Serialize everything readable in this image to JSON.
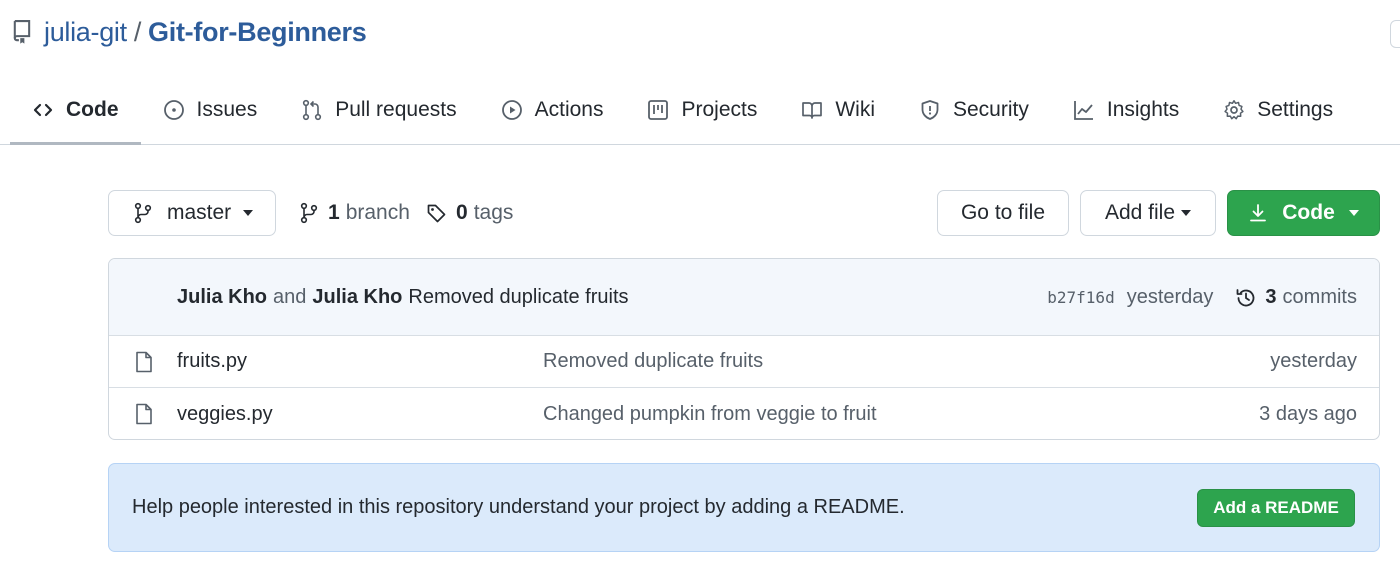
{
  "repo": {
    "owner": "julia-git",
    "separator": "/",
    "name": "Git-for-Beginners"
  },
  "tabs": [
    {
      "label": "Code",
      "icon": "code-icon",
      "active": true
    },
    {
      "label": "Issues",
      "icon": "issue-opened-icon"
    },
    {
      "label": "Pull requests",
      "icon": "git-pull-request-icon"
    },
    {
      "label": "Actions",
      "icon": "play-icon"
    },
    {
      "label": "Projects",
      "icon": "table-icon"
    },
    {
      "label": "Wiki",
      "icon": "book-icon"
    },
    {
      "label": "Security",
      "icon": "shield-icon"
    },
    {
      "label": "Insights",
      "icon": "graph-icon"
    },
    {
      "label": "Settings",
      "icon": "gear-icon"
    }
  ],
  "toolbar": {
    "branch_name": "master",
    "branch_count": "1",
    "branch_label": "branch",
    "tag_count": "0",
    "tag_label": "tags",
    "go_to_file": "Go to file",
    "add_file": "Add file",
    "code": "Code"
  },
  "latest_commit": {
    "author1": "Julia Kho",
    "connector": "and",
    "author2": "Julia Kho",
    "message": "Removed duplicate fruits",
    "sha": "b27f16d",
    "time": "yesterday",
    "commit_count": "3",
    "commits_label": "commits"
  },
  "files": [
    {
      "name": "fruits.py",
      "message": "Removed duplicate fruits",
      "time": "yesterday"
    },
    {
      "name": "veggies.py",
      "message": "Changed pumpkin from veggie to fruit",
      "time": "3 days ago"
    }
  ],
  "readme_prompt": {
    "text": "Help people interested in this repository understand your project by adding a README.",
    "button": "Add a README"
  },
  "colors": {
    "accent_green": "#2da44e",
    "link_blue": "#2d5c9a",
    "readme_bg": "#dbeafb"
  }
}
